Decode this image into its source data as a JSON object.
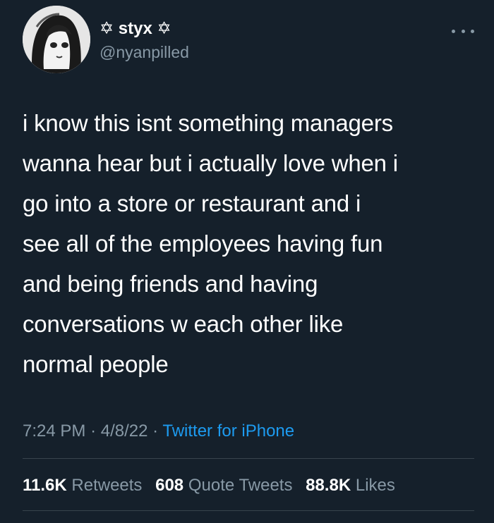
{
  "tweet": {
    "display_name": "✡ styx ✡",
    "handle": "@nyanpilled",
    "more_icon": "more-horizontal-icon",
    "text": "i know this isnt something managers\nwanna hear but i actually love when i\ngo into a store or restaurant and i\nsee all of the employees having fun\nand being friends and having\nconversations w each other like\nnormal people",
    "time": "7:24 PM",
    "date": "4/8/22",
    "separator": "·",
    "source": "Twitter for iPhone",
    "retweets_count": "11.6K",
    "retweets_label": "Retweets",
    "quote_count": "608",
    "quote_label": "Quote Tweets",
    "likes_count": "88.8K",
    "likes_label": "Likes"
  },
  "colors": {
    "background": "#15202b",
    "text": "#ffffff",
    "secondary": "#8899a6",
    "link": "#1d9bf0",
    "divider": "#38444d"
  }
}
